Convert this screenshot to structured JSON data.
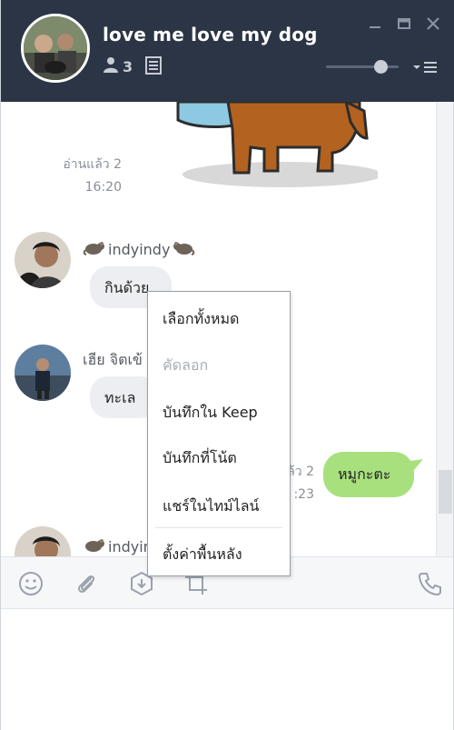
{
  "window": {
    "title": "love me love my dog",
    "member_count": "3",
    "icons": [
      "minimize-icon",
      "maximize-icon",
      "close-icon"
    ]
  },
  "header": {
    "volume_level": 0.82
  },
  "messages": {
    "read1": {
      "status": "อ่านแล้ว 2",
      "time": "16:20"
    },
    "sender1": {
      "name": "indyindy",
      "text": "กินด้วย"
    },
    "sender2": {
      "name": "เฮีย จิตเข้",
      "text": "ทะเล"
    },
    "outgoing": {
      "text": "หมูกะตะ",
      "status_partial": "ล้ว 2",
      "time_partial": ":23"
    },
    "sender3": {
      "name": "indyin"
    }
  },
  "context_menu": {
    "items": [
      {
        "label": "เลือกทั้งหมด",
        "enabled": true
      },
      {
        "label": "คัดลอก",
        "enabled": false
      },
      {
        "label": "บันทึกใน Keep",
        "enabled": true
      },
      {
        "label": "บันทึกที่โน้ต",
        "enabled": true
      },
      {
        "label": "แชร์ในไทม์ไลน์",
        "enabled": true
      },
      {
        "label": "ตั้งค่าพื้นหลัง",
        "enabled": true
      }
    ]
  },
  "toolbar": {
    "icons": [
      "emoji-icon",
      "attach-icon",
      "keep-icon",
      "crop-icon",
      "call-icon"
    ]
  },
  "colors": {
    "header_bg": "#2c3546",
    "bubble_out": "#a8e07e",
    "bubble_in": "#eceef1"
  }
}
